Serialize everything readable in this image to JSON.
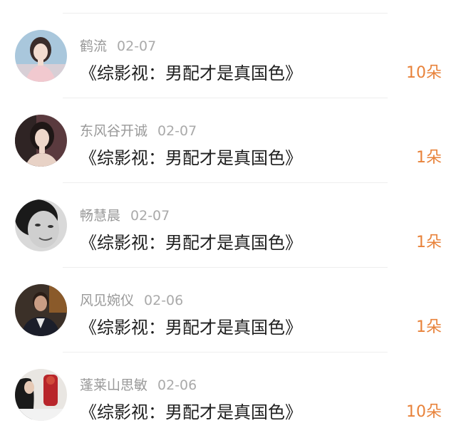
{
  "comments": [
    {
      "name": "鹤流",
      "date": "02-07",
      "title": "《综影视：男配才是真国色》",
      "count": "10朵",
      "avatar": "avatar-woman-pink-dress"
    },
    {
      "name": "东风谷开诚",
      "date": "02-07",
      "title": "《综影视：男配才是真国色》",
      "count": "1朵",
      "avatar": "avatar-woman-dark-hair"
    },
    {
      "name": "畅慧晨",
      "date": "02-07",
      "title": "《综影视：男配才是真国色》",
      "count": "1朵",
      "avatar": "avatar-bw-portrait"
    },
    {
      "name": "风见婉仪",
      "date": "02-06",
      "title": "《综影视：男配才是真国色》",
      "count": "1朵",
      "avatar": "avatar-man-suit"
    },
    {
      "name": "蓬莱山思敏",
      "date": "02-06",
      "title": "《综影视：男配才是真国色》",
      "count": "10朵",
      "avatar": "avatar-woman-red-figure"
    }
  ],
  "colors": {
    "count_accent": "#e8823a",
    "name_gray": "#999999",
    "title_text": "#1f1f1f"
  }
}
